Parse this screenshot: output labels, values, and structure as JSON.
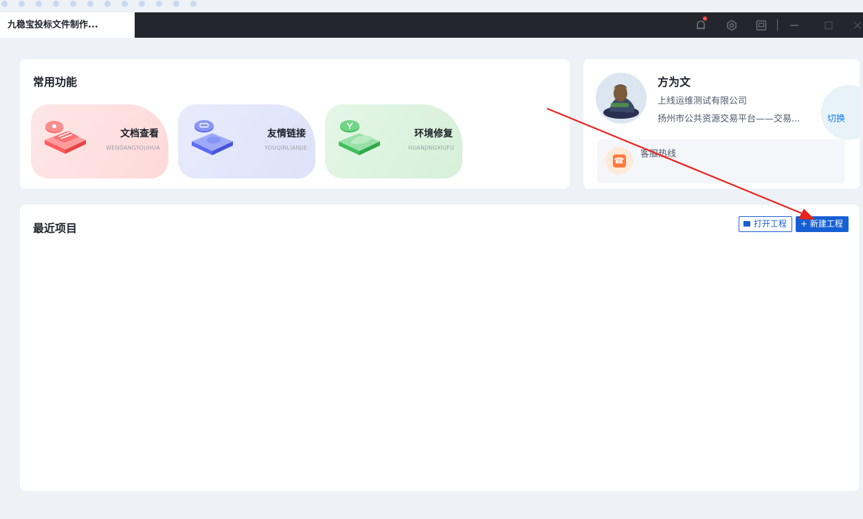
{
  "window": {
    "tab_title": "九稳宝投标文件制作..."
  },
  "titlebar_icons": [
    "bell-icon",
    "gear-icon",
    "screen-icon",
    "minimize-icon",
    "maximize-icon",
    "close-icon"
  ],
  "common": {
    "title": "常用功能",
    "features": [
      {
        "title": "文档查看",
        "subtitle": "WENDANGYOUHUA",
        "icon": "document-icon",
        "color": "#ff5b5b"
      },
      {
        "title": "友情链接",
        "subtitle": "YOUQINLIANJIE",
        "icon": "link-icon",
        "color": "#5b6cf5"
      },
      {
        "title": "环境修复",
        "subtitle": "HUANJINGXIUFU",
        "icon": "wrench-icon",
        "color": "#3fbf5a"
      }
    ]
  },
  "user": {
    "name": "方为文",
    "company": "上线运维测试有限公司",
    "platform": "扬州市公共资源交易平台——交易...",
    "switch_label": "切换",
    "hotline_label": "客服热线"
  },
  "recent": {
    "title": "最近项目",
    "open_label": "打开工程",
    "new_label": "新建工程"
  },
  "colors": {
    "primary": "#1660d4",
    "titlebar": "#23262c",
    "annotation_arrow": "#e8221c"
  }
}
